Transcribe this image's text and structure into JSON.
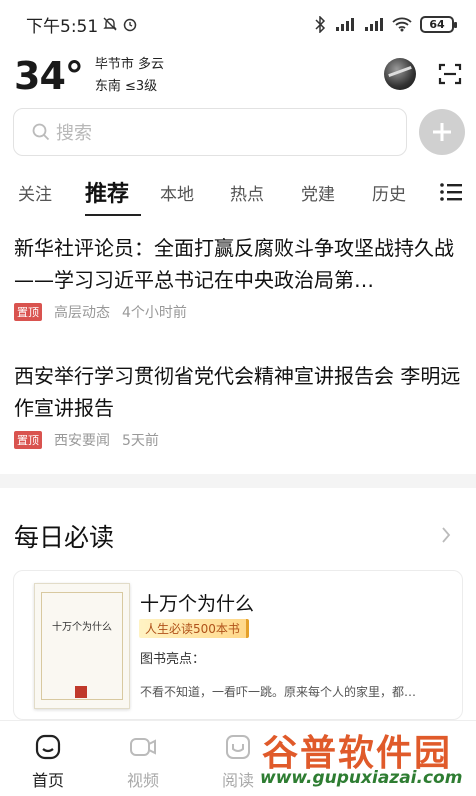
{
  "status_bar": {
    "time": "下午5:51",
    "battery": "64"
  },
  "weather": {
    "temperature": "34°",
    "city_condition": "毕节市 多云",
    "wind": "东南 ≤3级"
  },
  "search": {
    "placeholder": "搜索"
  },
  "tabs": [
    {
      "label": "关注",
      "active": false
    },
    {
      "label": "推荐",
      "active": true
    },
    {
      "label": "本地",
      "active": false
    },
    {
      "label": "热点",
      "active": false
    },
    {
      "label": "党建",
      "active": false
    },
    {
      "label": "历史",
      "active": false
    }
  ],
  "articles": [
    {
      "title": "新华社评论员：全面打赢反腐败斗争攻坚战持久战——学习习近平总书记在中央政治局第…",
      "tag": "置顶",
      "source": "高层动态",
      "time": "4个小时前"
    },
    {
      "title": "西安举行学习贯彻省党代会精神宣讲报告会 李明远作宣讲报告",
      "tag": "置顶",
      "source": "西安要闻",
      "time": "5天前"
    }
  ],
  "daily": {
    "title": "每日必读",
    "book": {
      "cover_title": "十万个为什么",
      "title": "十万个为什么",
      "badge": "人生必读500本书",
      "highlight_label": "图书亮点：",
      "description": "不看不知道，一看吓一跳。原来每个人的家里，都…"
    }
  },
  "bottom_nav": [
    {
      "label": "首页",
      "icon": "home-icon",
      "active": true
    },
    {
      "label": "视频",
      "icon": "video-icon",
      "active": false
    },
    {
      "label": "阅读",
      "icon": "reading-icon",
      "active": false
    }
  ],
  "watermark": {
    "brand": "谷普软件园",
    "url": "www.gupuxiazai.com"
  },
  "colors": {
    "tag_red": "#d9534f",
    "watermark_orange": "#e05a2a",
    "watermark_green": "#2e7d32"
  }
}
